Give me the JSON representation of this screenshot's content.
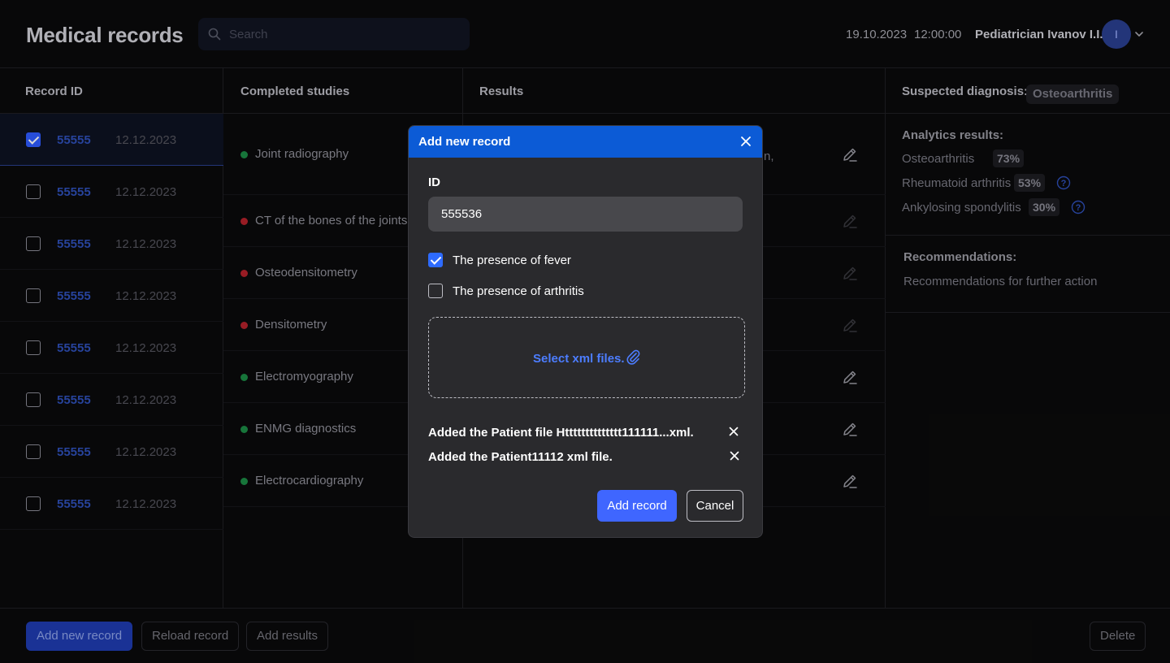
{
  "header": {
    "title": "Medical records",
    "search_placeholder": "Search",
    "date": "19.10.2023",
    "time": "12:00:00",
    "user": "Pediatrician Ivanov I.I.",
    "avatar_initial": "I"
  },
  "columns": {
    "record_id": "Record ID",
    "completed_studies": "Completed studies",
    "results": "Results"
  },
  "records": [
    {
      "id": "55555",
      "date": "12.12.2023",
      "checked": true
    },
    {
      "id": "55555",
      "date": "12.12.2023",
      "checked": false
    },
    {
      "id": "55555",
      "date": "12.12.2023",
      "checked": false
    },
    {
      "id": "55555",
      "date": "12.12.2023",
      "checked": false
    },
    {
      "id": "55555",
      "date": "12.12.2023",
      "checked": false
    },
    {
      "id": "55555",
      "date": "12.12.2023",
      "checked": false
    },
    {
      "id": "55555",
      "date": "12.12.2023",
      "checked": false
    },
    {
      "id": "55555",
      "date": "12.12.2023",
      "checked": false
    }
  ],
  "studies": [
    {
      "name": "Joint radiography",
      "status": "green"
    },
    {
      "name": "CT of the bones of the joints",
      "status": "red"
    },
    {
      "name": "Osteodensitometry",
      "status": "red"
    },
    {
      "name": "Densitometry",
      "status": "red"
    },
    {
      "name": "Electromyography",
      "status": "green"
    },
    {
      "name": "ENMG diagnostics",
      "status": "green"
    },
    {
      "name": "Electrocardiography",
      "status": "green"
    }
  ],
  "results_partial_text": "n,",
  "diagnosis": {
    "label": "Suspected diagnosis:",
    "value": "Osteoarthritis",
    "analytics_title": "Analytics results:",
    "analytics": [
      {
        "name": "Osteoarthritis",
        "percent": "73%",
        "help": false
      },
      {
        "name": "Rheumatoid arthritis",
        "percent": "53%",
        "help": true
      },
      {
        "name": "Ankylosing spondylitis",
        "percent": "30%",
        "help": true
      }
    ],
    "recommendations_title": "Recommendations:",
    "recommendations_text": "Recommendations for further action"
  },
  "footer": {
    "add_new_record": "Add new record",
    "reload_record": "Reload record",
    "add_results": "Add results",
    "delete": "Delete"
  },
  "modal": {
    "title": "Add new record",
    "id_label": "ID",
    "id_value": "555536",
    "fever_label": "The presence of fever",
    "fever_checked": true,
    "arthritis_label": "The presence of arthritis",
    "arthritis_checked": false,
    "dropzone_text": "Select xml files.",
    "files": [
      "Added the Patient file Htttttttttttttt111111...xml.",
      "Added the Patient11112 xml file."
    ],
    "add_button": "Add record",
    "cancel_button": "Cancel"
  },
  "colors": {
    "accent": "#0c5bd6",
    "primary_button": "#3f66ff",
    "status_ok": "#1c8a45",
    "status_bad": "#b3212b"
  },
  "icons": {
    "search": "search-icon",
    "chevron": "chevron-down-icon",
    "edit": "pencil-icon",
    "help": "help-icon",
    "close": "close-icon",
    "attach": "paperclip-icon"
  }
}
